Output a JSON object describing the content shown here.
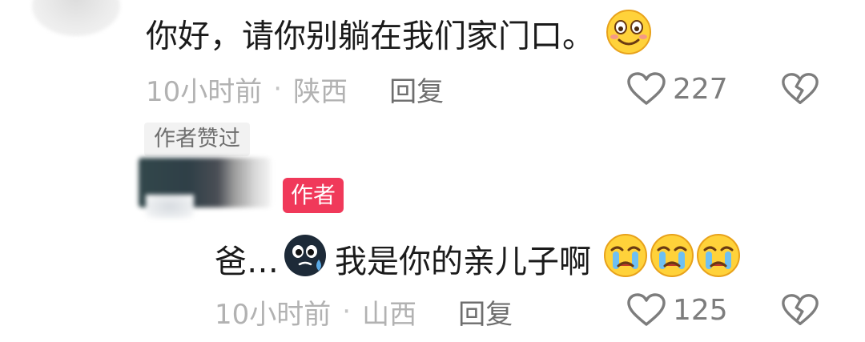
{
  "comment": {
    "text": "你好，请你别躺在我们家门口。",
    "emoji": "smiling-face-icon",
    "time": "10小时前",
    "separator": "·",
    "location": "陕西",
    "reply_label": "回复",
    "like_count": "227",
    "author_liked_tag": "作者赞过"
  },
  "reply": {
    "author_badge": "作者",
    "text_before": "爸…",
    "emoji_mid": "sweat-face-icon",
    "text_after": "我是你的亲儿子啊",
    "emoji_end": [
      "crying-face-icon",
      "crying-face-icon",
      "crying-face-icon"
    ],
    "time": "10小时前",
    "separator": "·",
    "location": "山西",
    "reply_label": "回复",
    "like_count": "125"
  },
  "colors": {
    "text_primary": "#1b1b1b",
    "text_meta": "#b2b2b2",
    "author_badge_bg": "#f0395a",
    "emoji_yellow": "#ffd23a"
  }
}
